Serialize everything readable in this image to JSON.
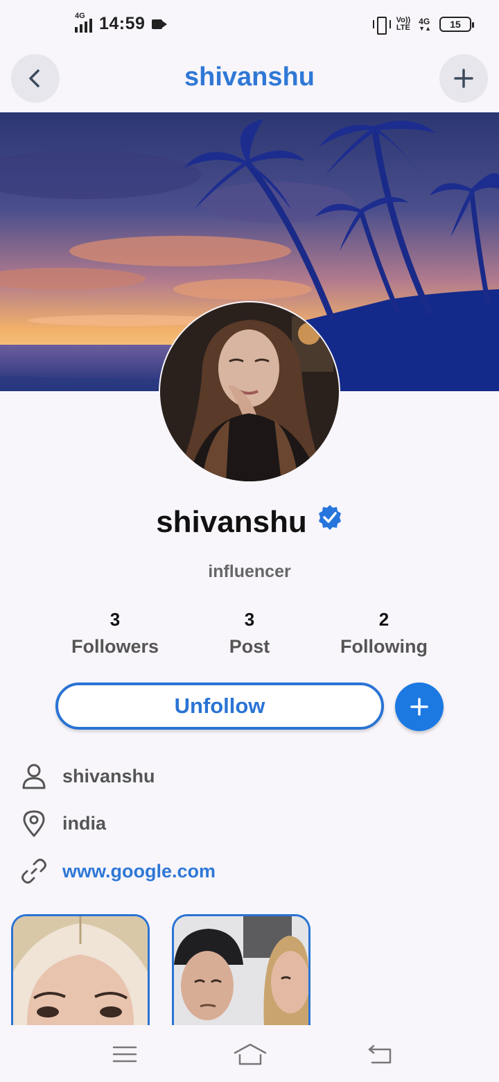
{
  "status_bar": {
    "network_type": "4G",
    "time": "14:59",
    "volte_top": "Vo))",
    "volte_bottom": "LTE",
    "network_type_right": "4G",
    "battery": "15"
  },
  "top_bar": {
    "title": "shivanshu",
    "back_icon": "chevron-left-icon",
    "add_icon": "plus-icon"
  },
  "profile": {
    "name": "shivanshu",
    "verified_icon": "verified-badge-icon",
    "subtitle": "influencer"
  },
  "stats": [
    {
      "count": "3",
      "label": "Followers"
    },
    {
      "count": "3",
      "label": "Post"
    },
    {
      "count": "2",
      "label": "Following"
    }
  ],
  "actions": {
    "unfollow_label": "Unfollow",
    "plus_icon": "plus-icon"
  },
  "info": {
    "username": "shivanshu",
    "location": "india",
    "website": "www.google.com"
  },
  "colors": {
    "accent": "#2f78d6",
    "button_fill": "#1c79e2",
    "background": "#f8f6fb"
  },
  "nav_bar": {
    "menu_icon": "menu-icon",
    "home_icon": "home-icon",
    "back_icon": "back-icon"
  }
}
